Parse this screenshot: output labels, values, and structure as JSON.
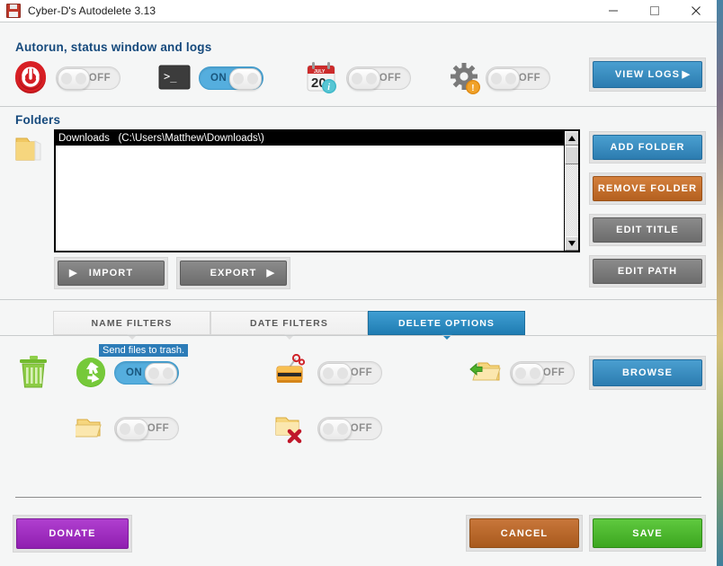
{
  "window": {
    "title": "Cyber-D's Autodelete 3.13",
    "app_icon": "floppy-disk-icon",
    "controls": {
      "minimize": "minimize-icon",
      "maximize": "maximize-icon",
      "close": "close-icon"
    }
  },
  "autorun_section": {
    "heading": "Autorun, status window and logs",
    "toggles": [
      {
        "icon": "power-icon",
        "state": "OFF"
      },
      {
        "icon": "console-icon",
        "state": "ON"
      },
      {
        "icon": "calendar-icon",
        "state": "OFF"
      },
      {
        "icon": "gear-warning-icon",
        "state": "OFF"
      }
    ],
    "view_logs_button": "VIEW LOGS"
  },
  "folders_section": {
    "heading": "Folders",
    "folder_icon": "folder-icon",
    "list": [
      "Downloads   (C:\\Users\\Matthew\\Downloads\\)"
    ],
    "import_button": "IMPORT",
    "export_button": "EXPORT",
    "side_buttons": [
      "ADD FOLDER",
      "REMOVE FOLDER",
      "EDIT TITLE",
      "EDIT PATH"
    ]
  },
  "tabs": [
    {
      "label": "NAME FILTERS",
      "active": false
    },
    {
      "label": "DATE FILTERS",
      "active": false
    },
    {
      "label": "DELETE OPTIONS",
      "active": true
    }
  ],
  "delete_options": {
    "tooltip": "Send files to trash.",
    "trash_icon": "trash-can-icon",
    "options": [
      {
        "icon": "recycle-icon",
        "state": "ON"
      },
      {
        "icon": "shredder-icon",
        "state": "OFF"
      },
      {
        "icon": "folder-move-icon",
        "state": "OFF"
      },
      {
        "icon": "folder-open-icon",
        "state": "OFF"
      },
      {
        "icon": "folder-delete-icon",
        "state": "OFF"
      }
    ],
    "browse_button": "BROWSE"
  },
  "footer": {
    "donate_button": "DONATE",
    "cancel_button": "CANCEL",
    "save_button": "SAVE"
  },
  "colors": {
    "heading": "#15497c",
    "accent_blue": "#2c7cb0",
    "orange": "#b4601f",
    "purple": "#8f1fb0",
    "green": "#3ca61f",
    "window_bg": "#f5f6f6"
  }
}
